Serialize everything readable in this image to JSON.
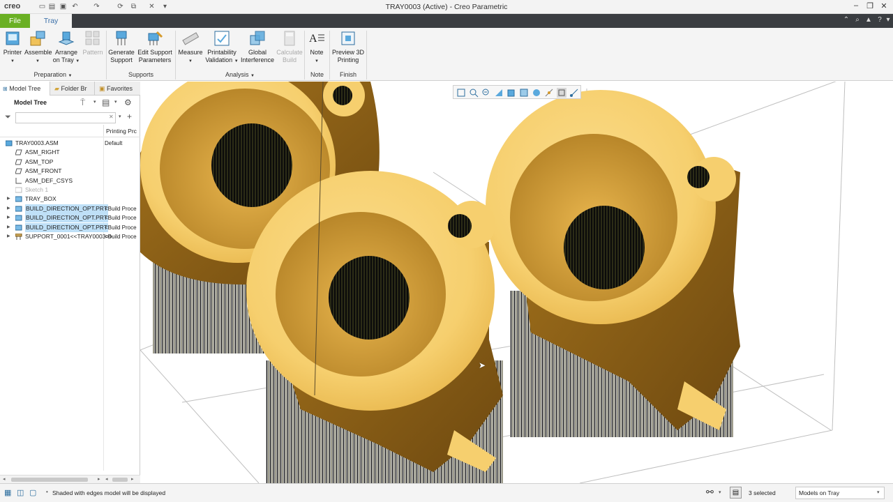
{
  "app": {
    "logo_text": "creo",
    "window_title": "TRAY0003 (Active) - Creo Parametric"
  },
  "ribbon_tabs": {
    "file": "File",
    "tray": "Tray"
  },
  "ribbon": {
    "buttons": {
      "printer": "Printer",
      "assemble": "Assemble",
      "arrange_line1": "Arrange",
      "arrange_line2": "on Tray",
      "pattern": "Pattern",
      "generate_line1": "Generate",
      "generate_line2": "Support",
      "edit_support_line1": "Edit Support",
      "edit_support_line2": "Parameters",
      "measure": "Measure",
      "printability_line1": "Printability",
      "printability_line2": "Validation",
      "global_line1": "Global",
      "global_line2": "Interference",
      "calculate_line1": "Calculate",
      "calculate_line2": "Build",
      "note": "Note",
      "preview_line1": "Preview 3D",
      "preview_line2": "Printing"
    },
    "groups": {
      "preparation": "Preparation",
      "supports": "Supports",
      "analysis": "Analysis",
      "note": "Note",
      "finish": "Finish"
    }
  },
  "left_panel": {
    "tabs": {
      "model_tree": "Model Tree",
      "folder_browser": "Folder Br",
      "favorites": "Favorites"
    },
    "header_title": "Model Tree",
    "filter_placeholder": "",
    "column_header": "Printing Prc",
    "rows": [
      {
        "name": "TRAY0003.ASM",
        "col2": "Default",
        "icon": "assembly-icon"
      },
      {
        "name": "ASM_RIGHT",
        "col2": "",
        "icon": "datum-plane-icon"
      },
      {
        "name": "ASM_TOP",
        "col2": "",
        "icon": "datum-plane-icon"
      },
      {
        "name": "ASM_FRONT",
        "col2": "",
        "icon": "datum-plane-icon"
      },
      {
        "name": "ASM_DEF_CSYS",
        "col2": "",
        "icon": "csys-icon"
      },
      {
        "name": "Sketch 1",
        "col2": "",
        "icon": "sketch-icon"
      },
      {
        "name": "TRAY_BOX",
        "col2": "",
        "icon": "part-icon"
      },
      {
        "name": "BUILD_DIRECTION_OPT.PRT",
        "col2": "<Build Proce",
        "icon": "part-icon"
      },
      {
        "name": "BUILD_DIRECTION_OPT.PRT",
        "col2": "<Build Proce",
        "icon": "part-icon"
      },
      {
        "name": "BUILD_DIRECTION_OPT.PRT",
        "col2": "<Build Proce",
        "icon": "part-icon"
      },
      {
        "name": "SUPPORT_0001<<TRAY0003>>",
        "col2": "<Build Proce",
        "icon": "support-icon"
      }
    ]
  },
  "status_bar": {
    "message": "Shaded with edges model will be displayed",
    "selected": "3 selected",
    "filter_value": "Models on Tray"
  },
  "colors": {
    "file_tab": "#6ab024",
    "dark_tabbar": "#3a3d41",
    "part_yellow": "#f6cf6e",
    "part_shadow": "#7d5512",
    "selection": "#bfe0f7"
  }
}
